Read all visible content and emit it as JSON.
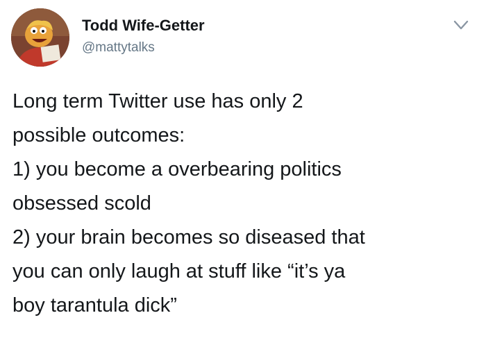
{
  "tweet": {
    "author": {
      "display_name": "Todd Wife-Getter",
      "handle": "@mattytalks",
      "avatar_icon": "muppet-avatar-icon"
    },
    "menu_icon": "chevron-down-icon",
    "text": "Long term Twitter use has only 2\npossible outcomes:\n1) you become a overbearing politics\nobsessed scold\n2) your brain becomes so diseased that\nyou can only laugh at stuff like “it’s ya\nboy tarantula dick”"
  },
  "colors": {
    "text": "#14171a",
    "secondary": "#657786",
    "caret": "#8a96a3",
    "background": "#ffffff"
  }
}
